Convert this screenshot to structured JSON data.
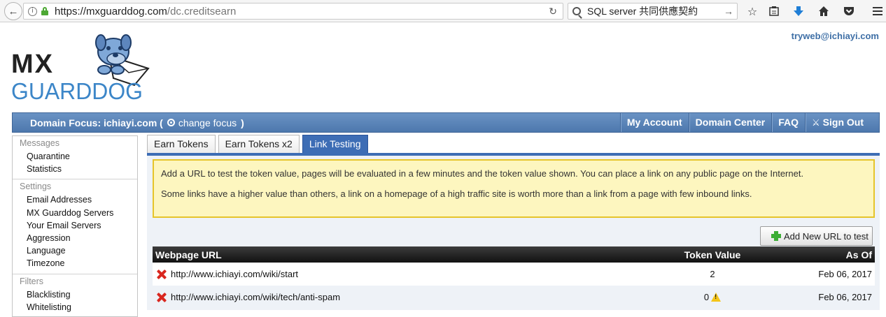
{
  "browser": {
    "url_host": "https://mxguarddog.com",
    "url_path": "/dc.creditsearn",
    "search_text": "SQL server 共同供應契約"
  },
  "header": {
    "logo_top": "MX",
    "logo_bottom": "GUARDDOG",
    "user_email": "tryweb@ichiayi.com"
  },
  "topnav": {
    "focus_label": "Domain Focus: ichiayi.com (",
    "change_focus": "change focus",
    "close_paren": ")",
    "items": [
      "My Account",
      "Domain Center",
      "FAQ",
      "Sign Out"
    ]
  },
  "sidebar": {
    "groups": [
      {
        "title": "Messages",
        "items": [
          "Quarantine",
          "Statistics"
        ]
      },
      {
        "title": "Settings",
        "items": [
          "Email Addresses",
          "MX Guarddog Servers",
          "Your Email Servers",
          "Aggression",
          "Language",
          "Timezone"
        ]
      },
      {
        "title": "Filters",
        "items": [
          "Blacklisting",
          "Whitelisting"
        ]
      }
    ]
  },
  "tabs": [
    "Earn Tokens",
    "Earn Tokens x2",
    "Link Testing"
  ],
  "active_tab": 2,
  "notice": {
    "line1": "Add a URL to test the token value, pages will be evaluated in a few minutes and the token value shown. You can place a link on any public page on the Internet.",
    "line2": "Some links have a higher value than others, a link on a homepage of a high traffic site is worth more than a link from a page with few inbound links."
  },
  "add_button_label": "Add New URL to test",
  "table": {
    "headers": [
      "Webpage URL",
      "Token Value",
      "As Of"
    ],
    "rows": [
      {
        "url": "http://www.ichiayi.com/wiki/start",
        "token": "2",
        "date": "Feb 06, 2017"
      },
      {
        "url": "http://www.ichiayi.com/wiki/tech/anti-spam",
        "token": "0",
        "date": "Feb 06, 2017"
      }
    ]
  },
  "colors": {
    "nav_blue": "#4d78ad",
    "tab_active": "#3d6db5",
    "notice_bg": "#fdf6bf",
    "notice_border": "#e6c42a",
    "email_blue": "#3e6fa6"
  }
}
